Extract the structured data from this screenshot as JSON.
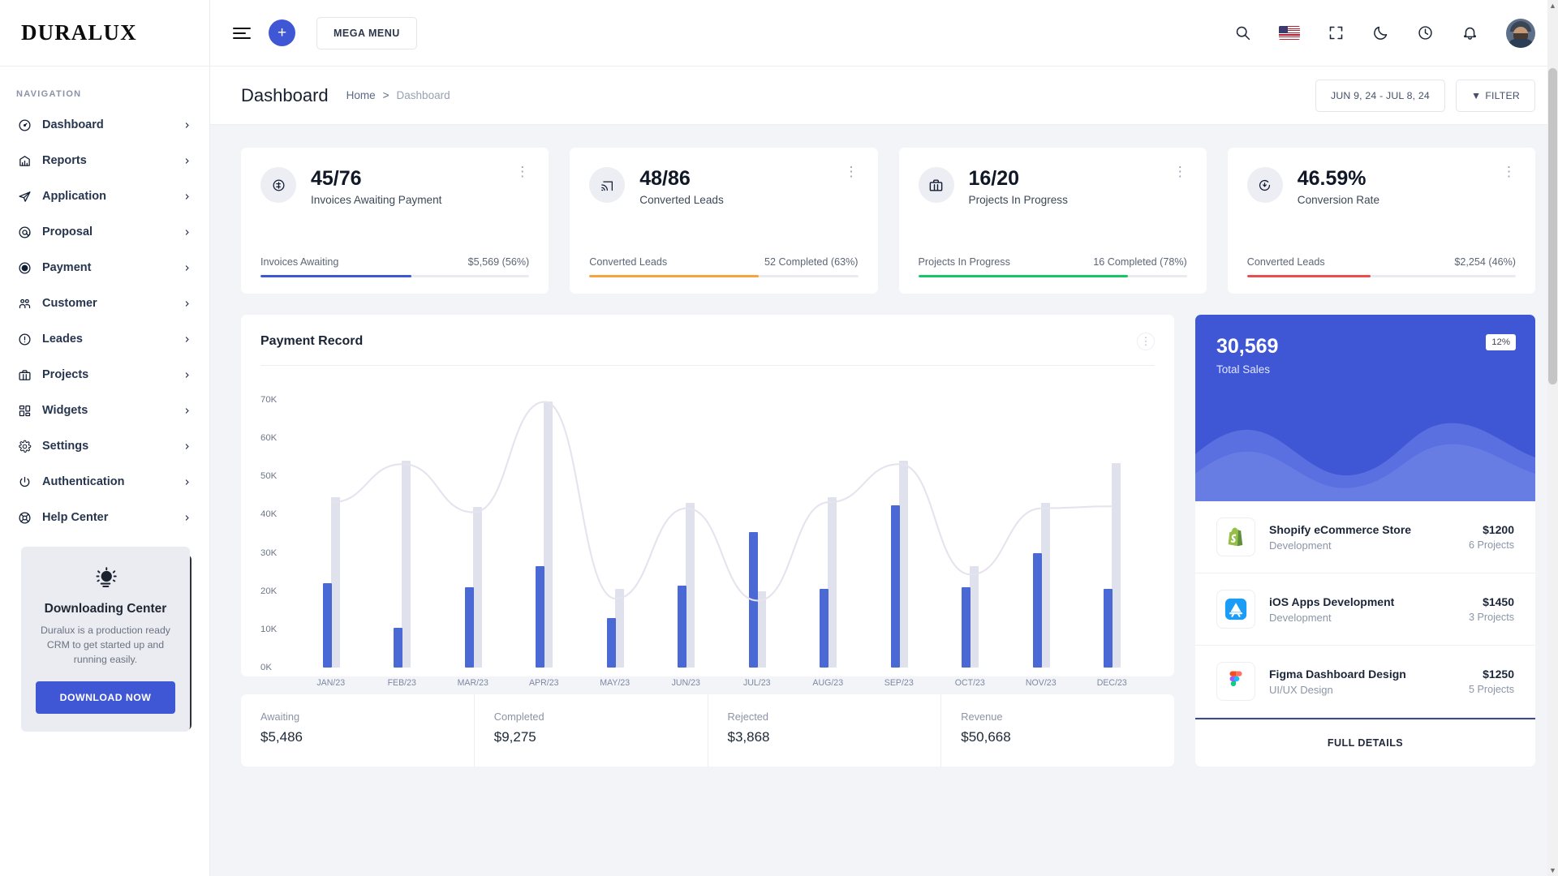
{
  "sidebar": {
    "logo": "DURALUX",
    "nav_label": "NAVIGATION",
    "items": [
      {
        "label": "Dashboard",
        "icon": "gauge-icon"
      },
      {
        "label": "Reports",
        "icon": "chart-icon"
      },
      {
        "label": "Application",
        "icon": "send-icon"
      },
      {
        "label": "Proposal",
        "icon": "at-icon"
      },
      {
        "label": "Payment",
        "icon": "coin-icon"
      },
      {
        "label": "Customer",
        "icon": "users-icon"
      },
      {
        "label": "Leades",
        "icon": "alert-icon"
      },
      {
        "label": "Projects",
        "icon": "briefcase-icon"
      },
      {
        "label": "Widgets",
        "icon": "grid-icon"
      },
      {
        "label": "Settings",
        "icon": "gear-icon"
      },
      {
        "label": "Authentication",
        "icon": "power-icon"
      },
      {
        "label": "Help Center",
        "icon": "lifebuoy-icon"
      }
    ],
    "promo": {
      "title": "Downloading Center",
      "description": "Duralux is a production ready CRM to get started up and running easily.",
      "button": "DOWNLOAD NOW",
      "icon": "bulb-icon"
    }
  },
  "topbar": {
    "menu_toggle": "menu-icon",
    "add_label": "+",
    "mega_menu": "MEGA MENU",
    "icons": [
      "search-icon",
      "flag-us-icon",
      "fullscreen-icon",
      "moon-icon",
      "clock-icon",
      "bell-icon",
      "avatar"
    ]
  },
  "pagehead": {
    "title": "Dashboard",
    "breadcrumb_home": "Home",
    "breadcrumb_sep": ">",
    "breadcrumb_current": "Dashboard",
    "date_range": "JUN 9, 24 - JUL 8, 24",
    "filter_label": "FILTER",
    "filter_icon": "funnel-icon"
  },
  "kpis": [
    {
      "value": "45/76",
      "caption": "Invoices Awaiting Payment",
      "icon": "dollar-circle-icon",
      "foot_label": "Invoices Awaiting",
      "foot_value": "$5,569 (56%)",
      "percent": 56,
      "color": "#3f57d4"
    },
    {
      "value": "48/86",
      "caption": "Converted Leads",
      "icon": "cast-icon",
      "foot_label": "Converted Leads",
      "foot_value": "52 Completed (63%)",
      "percent": 63,
      "color": "#f6a340"
    },
    {
      "value": "16/20",
      "caption": "Projects In Progress",
      "icon": "briefcase-icon",
      "foot_label": "Projects In Progress",
      "foot_value": "16 Completed (78%)",
      "percent": 78,
      "color": "#17c666"
    },
    {
      "value": "46.59%",
      "caption": "Conversion Rate",
      "icon": "refresh-down-icon",
      "foot_label": "Converted Leads",
      "foot_value": "$2,254 (46%)",
      "percent": 46,
      "color": "#ea4d4d"
    }
  ],
  "payment_record": {
    "title": "Payment Record",
    "menu_icon": "dots-vertical-icon"
  },
  "chart_data": {
    "type": "bar",
    "title": "Payment Record",
    "xlabel": "",
    "ylabel": "",
    "ylim": [
      0,
      70000
    ],
    "yticks": [
      0,
      10000,
      20000,
      30000,
      40000,
      50000,
      60000,
      70000
    ],
    "ytick_labels": [
      "0K",
      "10K",
      "20K",
      "30K",
      "40K",
      "50K",
      "60K",
      "70K"
    ],
    "grid": false,
    "legend": "none",
    "categories": [
      "JAN/23",
      "FEB/23",
      "MAR/23",
      "APR/23",
      "MAY/23",
      "JUN/23",
      "JUL/23",
      "AUG/23",
      "SEP/23",
      "OCT/23",
      "NOV/23",
      "DEC/23"
    ],
    "series": [
      {
        "name": "Payment",
        "color": "#4a69d4",
        "values": [
          22000,
          10500,
          21000,
          26500,
          13000,
          21500,
          35500,
          20500,
          42500,
          21000,
          30000,
          20500
        ]
      },
      {
        "name": "Target",
        "color": "#dfe2ec",
        "values": [
          44500,
          54000,
          42000,
          69500,
          20500,
          43000,
          20000,
          44500,
          54000,
          26500,
          43000,
          53500
        ]
      },
      {
        "name": "Trend",
        "color": "#e7e4f1",
        "type": "line",
        "values": [
          44500,
          54000,
          42000,
          69500,
          20500,
          43000,
          20000,
          44500,
          54000,
          26500,
          43000,
          43500
        ]
      }
    ]
  },
  "stat_strip": [
    {
      "label": "Awaiting",
      "value": "$5,486"
    },
    {
      "label": "Completed",
      "value": "$9,275"
    },
    {
      "label": "Rejected",
      "value": "$3,868"
    },
    {
      "label": "Revenue",
      "value": "$50,668"
    }
  ],
  "sales_panel": {
    "value": "30,569",
    "caption": "Total Sales",
    "badge": "12%",
    "bg_color": "#3f57d4",
    "projects": [
      {
        "name": "Shopify eCommerce Store",
        "category": "Development",
        "amount": "$1200",
        "count": "6 Projects",
        "icon": "shopify-icon"
      },
      {
        "name": "iOS Apps Development",
        "category": "Development",
        "amount": "$1450",
        "count": "3 Projects",
        "icon": "appstore-icon"
      },
      {
        "name": "Figma Dashboard Design",
        "category": "UI/UX Design",
        "amount": "$1250",
        "count": "5 Projects",
        "icon": "figma-icon"
      }
    ],
    "full_details": "FULL DETAILS"
  }
}
